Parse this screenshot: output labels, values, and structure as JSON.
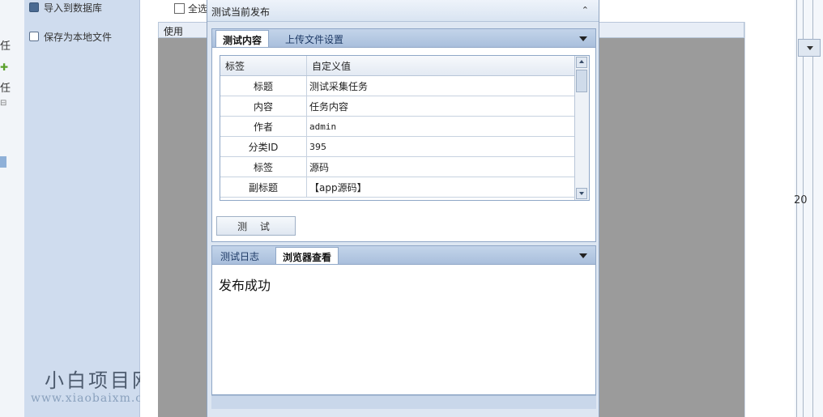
{
  "left_strip": {
    "chars": [
      "任",
      "任"
    ],
    "markers": [
      "⊟"
    ]
  },
  "left_panel": {
    "items": [
      {
        "label": "导入到数据库",
        "icon": "database-icon"
      },
      {
        "label": "保存为本地文件",
        "icon": "file-save-icon"
      }
    ]
  },
  "watermark": {
    "brand": "小白项目网",
    "url": "www.xiaobaixm.com"
  },
  "toolbar": {
    "select_all_label": "全选"
  },
  "table_header": {
    "use_col": "使用"
  },
  "right_frame": {
    "number": "20"
  },
  "dialog": {
    "title": "测试当前发布",
    "pin_icon": "pin-icon",
    "top_tabs": [
      {
        "label": "测试内容",
        "active": true
      },
      {
        "label": "上传文件设置",
        "active": false
      }
    ],
    "grid": {
      "headers": [
        "标签",
        "自定义值"
      ],
      "rows": [
        {
          "label": "标题",
          "value": "测试采集任务"
        },
        {
          "label": "内容",
          "value": "任务内容"
        },
        {
          "label": "作者",
          "value": "admin"
        },
        {
          "label": "分类ID",
          "value": "395"
        },
        {
          "label": "标签",
          "value": "源码"
        },
        {
          "label": "副标题",
          "value": "【app源码】"
        }
      ]
    },
    "test_button": "测 试",
    "bottom_tabs": [
      {
        "label": "测试日志",
        "active": false
      },
      {
        "label": "浏览器查看",
        "active": true
      }
    ],
    "log_text": "发布成功"
  }
}
